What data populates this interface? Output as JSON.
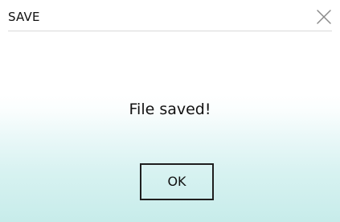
{
  "dialog": {
    "title": "SAVE",
    "message": "File saved!",
    "ok_label": "OK",
    "close_icon": "close-icon",
    "colors": {
      "text": "#111111",
      "divider": "#d9d9d9",
      "gradient_light": "#ffffff",
      "gradient_dark": "#c7ecea",
      "button_border": "#1f1f1f"
    }
  }
}
